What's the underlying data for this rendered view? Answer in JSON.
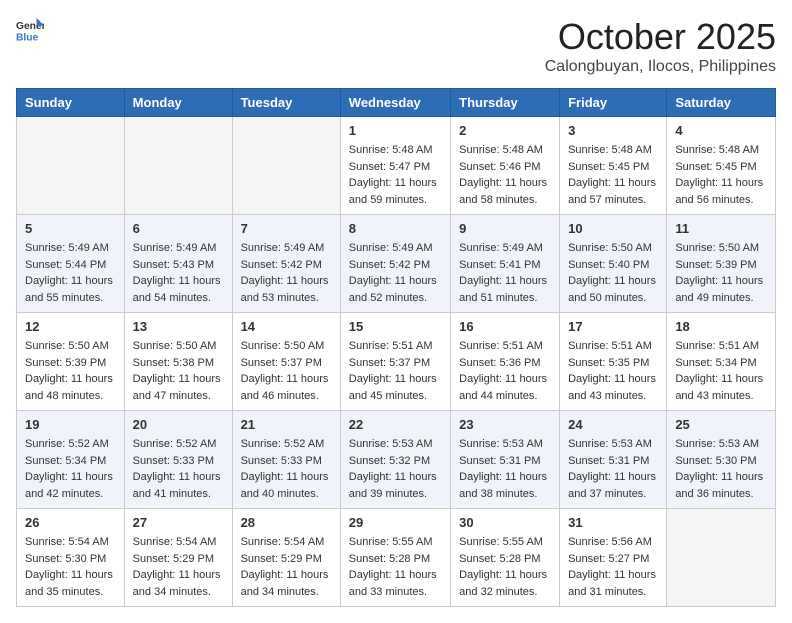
{
  "header": {
    "logo_line1": "General",
    "logo_line2": "Blue",
    "month_title": "October 2025",
    "subtitle": "Calongbuyan, Ilocos, Philippines"
  },
  "days_of_week": [
    "Sunday",
    "Monday",
    "Tuesday",
    "Wednesday",
    "Thursday",
    "Friday",
    "Saturday"
  ],
  "weeks": [
    [
      {
        "day": "",
        "empty": true
      },
      {
        "day": "",
        "empty": true
      },
      {
        "day": "",
        "empty": true
      },
      {
        "day": "1",
        "sunrise": "5:48 AM",
        "sunset": "5:47 PM",
        "daylight": "11 hours and 59 minutes."
      },
      {
        "day": "2",
        "sunrise": "5:48 AM",
        "sunset": "5:46 PM",
        "daylight": "11 hours and 58 minutes."
      },
      {
        "day": "3",
        "sunrise": "5:48 AM",
        "sunset": "5:45 PM",
        "daylight": "11 hours and 57 minutes."
      },
      {
        "day": "4",
        "sunrise": "5:48 AM",
        "sunset": "5:45 PM",
        "daylight": "11 hours and 56 minutes."
      }
    ],
    [
      {
        "day": "5",
        "sunrise": "5:49 AM",
        "sunset": "5:44 PM",
        "daylight": "11 hours and 55 minutes."
      },
      {
        "day": "6",
        "sunrise": "5:49 AM",
        "sunset": "5:43 PM",
        "daylight": "11 hours and 54 minutes."
      },
      {
        "day": "7",
        "sunrise": "5:49 AM",
        "sunset": "5:42 PM",
        "daylight": "11 hours and 53 minutes."
      },
      {
        "day": "8",
        "sunrise": "5:49 AM",
        "sunset": "5:42 PM",
        "daylight": "11 hours and 52 minutes."
      },
      {
        "day": "9",
        "sunrise": "5:49 AM",
        "sunset": "5:41 PM",
        "daylight": "11 hours and 51 minutes."
      },
      {
        "day": "10",
        "sunrise": "5:50 AM",
        "sunset": "5:40 PM",
        "daylight": "11 hours and 50 minutes."
      },
      {
        "day": "11",
        "sunrise": "5:50 AM",
        "sunset": "5:39 PM",
        "daylight": "11 hours and 49 minutes."
      }
    ],
    [
      {
        "day": "12",
        "sunrise": "5:50 AM",
        "sunset": "5:39 PM",
        "daylight": "11 hours and 48 minutes."
      },
      {
        "day": "13",
        "sunrise": "5:50 AM",
        "sunset": "5:38 PM",
        "daylight": "11 hours and 47 minutes."
      },
      {
        "day": "14",
        "sunrise": "5:50 AM",
        "sunset": "5:37 PM",
        "daylight": "11 hours and 46 minutes."
      },
      {
        "day": "15",
        "sunrise": "5:51 AM",
        "sunset": "5:37 PM",
        "daylight": "11 hours and 45 minutes."
      },
      {
        "day": "16",
        "sunrise": "5:51 AM",
        "sunset": "5:36 PM",
        "daylight": "11 hours and 44 minutes."
      },
      {
        "day": "17",
        "sunrise": "5:51 AM",
        "sunset": "5:35 PM",
        "daylight": "11 hours and 43 minutes."
      },
      {
        "day": "18",
        "sunrise": "5:51 AM",
        "sunset": "5:34 PM",
        "daylight": "11 hours and 43 minutes."
      }
    ],
    [
      {
        "day": "19",
        "sunrise": "5:52 AM",
        "sunset": "5:34 PM",
        "daylight": "11 hours and 42 minutes."
      },
      {
        "day": "20",
        "sunrise": "5:52 AM",
        "sunset": "5:33 PM",
        "daylight": "11 hours and 41 minutes."
      },
      {
        "day": "21",
        "sunrise": "5:52 AM",
        "sunset": "5:33 PM",
        "daylight": "11 hours and 40 minutes."
      },
      {
        "day": "22",
        "sunrise": "5:53 AM",
        "sunset": "5:32 PM",
        "daylight": "11 hours and 39 minutes."
      },
      {
        "day": "23",
        "sunrise": "5:53 AM",
        "sunset": "5:31 PM",
        "daylight": "11 hours and 38 minutes."
      },
      {
        "day": "24",
        "sunrise": "5:53 AM",
        "sunset": "5:31 PM",
        "daylight": "11 hours and 37 minutes."
      },
      {
        "day": "25",
        "sunrise": "5:53 AM",
        "sunset": "5:30 PM",
        "daylight": "11 hours and 36 minutes."
      }
    ],
    [
      {
        "day": "26",
        "sunrise": "5:54 AM",
        "sunset": "5:30 PM",
        "daylight": "11 hours and 35 minutes."
      },
      {
        "day": "27",
        "sunrise": "5:54 AM",
        "sunset": "5:29 PM",
        "daylight": "11 hours and 34 minutes."
      },
      {
        "day": "28",
        "sunrise": "5:54 AM",
        "sunset": "5:29 PM",
        "daylight": "11 hours and 34 minutes."
      },
      {
        "day": "29",
        "sunrise": "5:55 AM",
        "sunset": "5:28 PM",
        "daylight": "11 hours and 33 minutes."
      },
      {
        "day": "30",
        "sunrise": "5:55 AM",
        "sunset": "5:28 PM",
        "daylight": "11 hours and 32 minutes."
      },
      {
        "day": "31",
        "sunrise": "5:56 AM",
        "sunset": "5:27 PM",
        "daylight": "11 hours and 31 minutes."
      },
      {
        "day": "",
        "empty": true
      }
    ]
  ],
  "labels": {
    "sunrise": "Sunrise:",
    "sunset": "Sunset:",
    "daylight": "Daylight:"
  }
}
